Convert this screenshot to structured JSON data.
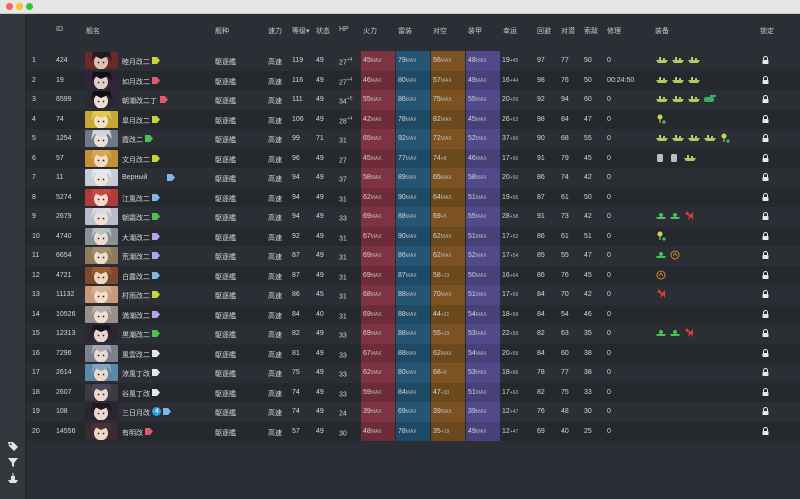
{
  "window": {
    "traffic_lights": [
      "close",
      "minimize",
      "maximize"
    ]
  },
  "colors": {
    "firepower": "#8e3a44",
    "torpedo": "#245d7e",
    "aa": "#8a5a24",
    "armor": "#5a4f93",
    "active_header": "#5aa9ff"
  },
  "sidebar": {
    "icons": [
      "tag-icon",
      "filter-icon",
      "fleet-icon"
    ]
  },
  "headers": {
    "id": "ID",
    "name": "舰名",
    "type": "舰种",
    "speed": "速力",
    "level": "等级",
    "status": "状态",
    "hp": "HP",
    "firepower": "火力",
    "torpedo": "雷装",
    "aa": "对空",
    "armor": "装甲",
    "luck": "幸运",
    "evasion": "回避",
    "asw": "对潜",
    "los": "索敌",
    "repair": "修理",
    "equipment": "装备",
    "lock": "锁定"
  },
  "ships": [
    {
      "no": "1",
      "id": "424",
      "name": "睦月改二",
      "tag": "#c8d43a",
      "type": "駆逐艦",
      "speed": "高速",
      "level": "119",
      "status": "49",
      "hp": "27",
      "hp_up": "+4",
      "fp": "45",
      "fp_sub": "MAX",
      "tp": "79",
      "tp_sub": "MAX",
      "aa": "56",
      "aa_sub": "MAX",
      "ar": "48",
      "ar_sub": "MAX",
      "luck": "19",
      "luck_sub": "+45",
      "ev": "97",
      "asw": "77",
      "los": "50",
      "repair": "0",
      "equip": [
        "ship",
        "ship",
        "ship"
      ]
    },
    {
      "no": "2",
      "id": "19",
      "name": "如月改二",
      "tag": "#e05a6c",
      "type": "駆逐艦",
      "speed": "高速",
      "level": "116",
      "status": "49",
      "hp": "27",
      "hp_up": "+4",
      "fp": "46",
      "fp_sub": "MAX",
      "tp": "80",
      "tp_sub": "MAX",
      "aa": "57",
      "aa_sub": "MAX",
      "ar": "49",
      "ar_sub": "MAX",
      "luck": "16",
      "luck_sub": "+44",
      "ev": "98",
      "asw": "76",
      "los": "50",
      "repair": "00:24:50",
      "equip": [
        "ship",
        "ship",
        "ship"
      ]
    },
    {
      "no": "3",
      "id": "6599",
      "name": "朝潮改二丁",
      "tag": "#e05a6c",
      "type": "駆逐艦",
      "speed": "高速",
      "level": "111",
      "status": "49",
      "hp": "34",
      "hp_up": "+5",
      "fp": "55",
      "fp_sub": "MAX",
      "tp": "86",
      "tp_sub": "MAX",
      "aa": "75",
      "aa_sub": "MAX",
      "ar": "55",
      "ar_sub": "MAX",
      "luck": "20",
      "luck_sub": "+59",
      "ev": "92",
      "asw": "94",
      "los": "60",
      "repair": "0",
      "equip": [
        "ship",
        "ship",
        "ship",
        "tank"
      ]
    },
    {
      "no": "4",
      "id": "74",
      "name": "皐月改二",
      "tag": "#c8d43a",
      "type": "駆逐艦",
      "speed": "高速",
      "level": "106",
      "status": "49",
      "hp": "28",
      "hp_up": "+4",
      "fp": "42",
      "fp_sub": "MAX",
      "tp": "78",
      "tp_sub": "MAX",
      "aa": "82",
      "aa_sub": "MAX",
      "ar": "45",
      "ar_sub": "MAX",
      "luck": "26",
      "luck_sub": "+53",
      "ev": "98",
      "asw": "84",
      "los": "47",
      "repair": "0",
      "equip": [
        "pin"
      ]
    },
    {
      "no": "5",
      "id": "1254",
      "name": "霞改二",
      "tag": "#4cbf4c",
      "type": "駆逐艦",
      "speed": "高速",
      "level": "99",
      "status": "71",
      "hp": "31",
      "hp_up": "",
      "fp": "65",
      "fp_sub": "MAX",
      "tp": "92",
      "tp_sub": "MAX",
      "aa": "72",
      "aa_sub": "MAX",
      "ar": "52",
      "ar_sub": "MAX",
      "luck": "37",
      "luck_sub": "+60",
      "ev": "90",
      "asw": "68",
      "los": "55",
      "repair": "0",
      "equip": [
        "ship",
        "ship",
        "ship",
        "ship",
        "pin"
      ]
    },
    {
      "no": "6",
      "id": "57",
      "name": "文月改二",
      "tag": "#c8d43a",
      "type": "駆逐艦",
      "speed": "高速",
      "level": "96",
      "status": "49",
      "hp": "27",
      "hp_up": "",
      "fp": "45",
      "fp_sub": "MAX",
      "tp": "77",
      "tp_sub": "MAX",
      "aa": "74",
      "aa_sub": "+8",
      "ar": "46",
      "ar_sub": "MAX",
      "luck": "17",
      "luck_sub": "+50",
      "ev": "91",
      "asw": "79",
      "los": "45",
      "repair": "0",
      "equip": [
        "drum",
        "drum",
        "ship"
      ]
    },
    {
      "no": "7",
      "id": "11",
      "name": "Верный",
      "tag": "#7fb7e8",
      "type": "駆逐艦",
      "speed": "高速",
      "level": "94",
      "status": "49",
      "hp": "37",
      "hp_up": "",
      "fp": "58",
      "fp_sub": "MAX",
      "tp": "89",
      "tp_sub": "MAX",
      "aa": "65",
      "aa_sub": "MAX",
      "ar": "58",
      "ar_sub": "MAX",
      "luck": "20",
      "luck_sub": "+50",
      "ev": "86",
      "asw": "74",
      "los": "42",
      "repair": "0",
      "equip": []
    },
    {
      "no": "8",
      "id": "5274",
      "name": "江風改二",
      "tag": "#7fb7e8",
      "type": "駆逐艦",
      "speed": "高速",
      "level": "94",
      "status": "49",
      "hp": "31",
      "hp_up": "",
      "fp": "62",
      "fp_sub": "MAX",
      "tp": "90",
      "tp_sub": "MAX",
      "aa": "64",
      "aa_sub": "MAX",
      "ar": "51",
      "ar_sub": "MAX",
      "luck": "19",
      "luck_sub": "+56",
      "ev": "87",
      "asw": "61",
      "los": "50",
      "repair": "0",
      "equip": []
    },
    {
      "no": "9",
      "id": "2679",
      "name": "朝霜改二",
      "tag": "#4cbf4c",
      "type": "駆逐艦",
      "speed": "高速",
      "level": "94",
      "status": "49",
      "hp": "33",
      "hp_up": "",
      "fp": "69",
      "fp_sub": "MAX",
      "tp": "88",
      "tp_sub": "MAX",
      "aa": "69",
      "aa_sub": "+5",
      "ar": "55",
      "ar_sub": "MAX",
      "luck": "28",
      "luck_sub": "+58",
      "ev": "91",
      "asw": "73",
      "los": "42",
      "repair": "0",
      "equip": [
        "drop",
        "drop",
        "gear"
      ]
    },
    {
      "no": "10",
      "id": "4740",
      "name": "大潮改二",
      "tag": "#b5a2f0",
      "type": "駆逐艦",
      "speed": "高速",
      "level": "92",
      "status": "49",
      "hp": "31",
      "hp_up": "",
      "fp": "67",
      "fp_sub": "MAX",
      "tp": "90",
      "tp_sub": "MAX",
      "aa": "62",
      "aa_sub": "MAX",
      "ar": "51",
      "ar_sub": "MAX",
      "luck": "17",
      "luck_sub": "+52",
      "ev": "86",
      "asw": "61",
      "los": "51",
      "repair": "0",
      "equip": [
        "pin"
      ]
    },
    {
      "no": "11",
      "id": "6654",
      "name": "荒潮改二",
      "tag": "#b5a2f0",
      "type": "駆逐艦",
      "speed": "高速",
      "level": "87",
      "status": "49",
      "hp": "31",
      "hp_up": "",
      "fp": "69",
      "fp_sub": "MAX",
      "tp": "86",
      "tp_sub": "MAX",
      "aa": "62",
      "aa_sub": "MAX",
      "ar": "52",
      "ar_sub": "MAX",
      "luck": "17",
      "luck_sub": "+54",
      "ev": "85",
      "asw": "55",
      "los": "47",
      "repair": "0",
      "equip": [
        "drop",
        "ring"
      ]
    },
    {
      "no": "12",
      "id": "4721",
      "name": "白露改二",
      "tag": "#7fb7e8",
      "type": "駆逐艦",
      "speed": "高速",
      "level": "87",
      "status": "49",
      "hp": "31",
      "hp_up": "",
      "fp": "69",
      "fp_sub": "MAX",
      "tp": "87",
      "tp_sub": "MAX",
      "aa": "58",
      "aa_sub": "+13",
      "ar": "50",
      "ar_sub": "MAX",
      "luck": "16",
      "luck_sub": "+64",
      "ev": "86",
      "asw": "76",
      "los": "45",
      "repair": "0",
      "equip": [
        "ring"
      ]
    },
    {
      "no": "13",
      "id": "11132",
      "name": "村雨改二",
      "tag": "#c8d43a",
      "type": "駆逐艦",
      "speed": "高速",
      "level": "86",
      "status": "45",
      "hp": "31",
      "hp_up": "",
      "fp": "68",
      "fp_sub": "MAX",
      "tp": "88",
      "tp_sub": "MAX",
      "aa": "70",
      "aa_sub": "MAX",
      "ar": "51",
      "ar_sub": "MAX",
      "luck": "17",
      "luck_sub": "+59",
      "ev": "84",
      "asw": "70",
      "los": "42",
      "repair": "0",
      "equip": [
        "gear"
      ]
    },
    {
      "no": "14",
      "id": "10526",
      "name": "満潮改二",
      "tag": "#b5a2f0",
      "type": "駆逐艦",
      "speed": "高速",
      "level": "84",
      "status": "40",
      "hp": "31",
      "hp_up": "",
      "fp": "69",
      "fp_sub": "MAX",
      "tp": "88",
      "tp_sub": "MAX",
      "aa": "44",
      "aa_sub": "+21",
      "ar": "54",
      "ar_sub": "MAX",
      "luck": "18",
      "luck_sub": "+59",
      "ev": "84",
      "asw": "54",
      "los": "46",
      "repair": "0",
      "equip": []
    },
    {
      "no": "15",
      "id": "12313",
      "name": "黒潮改二",
      "tag": "#4cbf4c",
      "type": "駆逐艦",
      "speed": "高速",
      "level": "82",
      "status": "49",
      "hp": "33",
      "hp_up": "",
      "fp": "69",
      "fp_sub": "MAX",
      "tp": "88",
      "tp_sub": "MAX",
      "aa": "55",
      "aa_sub": "+19",
      "ar": "53",
      "ar_sub": "MAX",
      "luck": "22",
      "luck_sub": "+59",
      "ev": "82",
      "asw": "63",
      "los": "35",
      "repair": "0",
      "equip": [
        "drop",
        "drop",
        "gear"
      ]
    },
    {
      "no": "16",
      "id": "7296",
      "name": "風雲改二",
      "tag": "#e6e6e6",
      "type": "駆逐艦",
      "speed": "高速",
      "level": "81",
      "status": "49",
      "hp": "33",
      "hp_up": "",
      "fp": "67",
      "fp_sub": "MAX",
      "tp": "88",
      "tp_sub": "MAX",
      "aa": "62",
      "aa_sub": "MAX",
      "ar": "54",
      "ar_sub": "MAX",
      "luck": "20",
      "luck_sub": "+59",
      "ev": "84",
      "asw": "60",
      "los": "38",
      "repair": "0",
      "equip": []
    },
    {
      "no": "17",
      "id": "2614",
      "name": "涼風丁改",
      "tag": "#e6e6e6",
      "type": "駆逐艦",
      "speed": "高速",
      "level": "75",
      "status": "49",
      "hp": "33",
      "hp_up": "",
      "fp": "62",
      "fp_sub": "MAX",
      "tp": "80",
      "tp_sub": "MAX",
      "aa": "68",
      "aa_sub": "+8",
      "ar": "53",
      "ar_sub": "MAX",
      "luck": "18",
      "luck_sub": "+66",
      "ev": "78",
      "asw": "77",
      "los": "38",
      "repair": "0",
      "equip": []
    },
    {
      "no": "18",
      "id": "2607",
      "name": "谷風丁改",
      "tag": "#e6e6e6",
      "type": "駆逐艦",
      "speed": "高速",
      "level": "74",
      "status": "49",
      "hp": "33",
      "hp_up": "",
      "fp": "59",
      "fp_sub": "MAX",
      "tp": "84",
      "tp_sub": "MAX",
      "aa": "47",
      "aa_sub": "+33",
      "ar": "51",
      "ar_sub": "MAX",
      "luck": "17",
      "luck_sub": "+63",
      "ev": "82",
      "asw": "75",
      "los": "33",
      "repair": "0",
      "equip": []
    },
    {
      "no": "19",
      "id": "108",
      "name": "三日月改",
      "badge": "4",
      "tag": "#7fb7e8",
      "type": "駆逐艦",
      "speed": "高速",
      "level": "74",
      "status": "49",
      "hp": "24",
      "hp_up": "",
      "fp": "39",
      "fp_sub": "MAX",
      "tp": "69",
      "tp_sub": "MAX",
      "aa": "39",
      "aa_sub": "MAX",
      "ar": "39",
      "ar_sub": "MAX",
      "luck": "12",
      "luck_sub": "+47",
      "ev": "76",
      "asw": "48",
      "los": "30",
      "repair": "0",
      "equip": []
    },
    {
      "no": "20",
      "id": "14556",
      "name": "有明改",
      "tag": "#e05a6c",
      "type": "駆逐艦",
      "speed": "高速",
      "level": "57",
      "status": "49",
      "hp": "30",
      "hp_up": "",
      "fp": "48",
      "fp_sub": "MAX",
      "tp": "78",
      "tp_sub": "MAX",
      "aa": "35",
      "aa_sub": "+19",
      "ar": "49",
      "ar_sub": "MAX",
      "luck": "12",
      "luck_sub": "+47",
      "ev": "69",
      "asw": "40",
      "los": "25",
      "repair": "0",
      "equip": []
    }
  ]
}
